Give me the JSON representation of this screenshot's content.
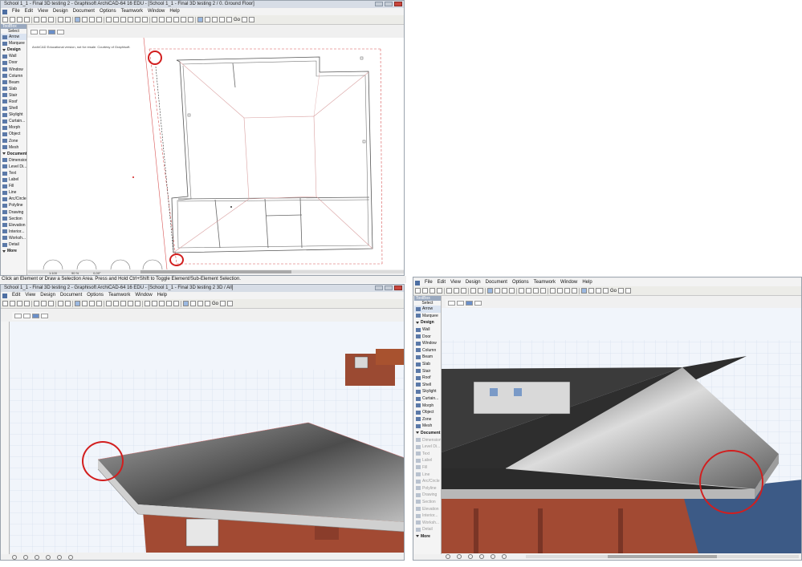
{
  "window_top": {
    "title": "School 1_1 - Final 3D testing 2 - Graphisoft ArchiCAD-64 16 EDU - [School 1_1 - Final 3D testing 2 / 0. Ground Floor]",
    "menu": [
      "File",
      "Edit",
      "View",
      "Design",
      "Document",
      "Options",
      "Teamwork",
      "Window",
      "Help"
    ],
    "zoom_label": "Go",
    "watermark": "ArchiCAD Educational version, not for resale. Courtesy of Graphisoft.",
    "scale_readout": "1:100",
    "zoom_readout": "90 %",
    "angle_readout": "0,00°"
  },
  "status_top": "Click an Element or Draw a Selection Area. Press and Hold Ctrl+Shift to Toggle Element/Sub-Element Selection.",
  "window_bottom_left": {
    "title": "School 1_1 - Final 3D testing 2 - Graphisoft ArchiCAD-64 16 EDU - [School 1_1 - Final 3D testing 2 3D / All]",
    "menu": [
      "Edit",
      "View",
      "Design",
      "Document",
      "Options",
      "Teamwork",
      "Window",
      "Help"
    ],
    "zoom_label": "Go"
  },
  "window_bottom_right": {
    "menu": [
      "File",
      "Edit",
      "View",
      "Design",
      "Document",
      "Options",
      "Teamwork",
      "Window",
      "Help"
    ],
    "zoom_label": "Go"
  },
  "toolbox": {
    "title": "ToolBox",
    "select_label": "Select",
    "items": [
      {
        "label": "Arrow",
        "kind": "tool",
        "icon": "arrow-icon"
      },
      {
        "label": "Marquee",
        "kind": "tool",
        "icon": "marquee-icon"
      },
      {
        "label": "Design",
        "kind": "group"
      },
      {
        "label": "Wall",
        "kind": "tool",
        "icon": "wall-icon"
      },
      {
        "label": "Door",
        "kind": "tool",
        "icon": "door-icon"
      },
      {
        "label": "Window",
        "kind": "tool",
        "icon": "window-icon"
      },
      {
        "label": "Column",
        "kind": "tool",
        "icon": "column-icon"
      },
      {
        "label": "Beam",
        "kind": "tool",
        "icon": "beam-icon"
      },
      {
        "label": "Slab",
        "kind": "tool",
        "icon": "slab-icon"
      },
      {
        "label": "Stair",
        "kind": "tool",
        "icon": "stair-icon"
      },
      {
        "label": "Roof",
        "kind": "tool",
        "icon": "roof-icon"
      },
      {
        "label": "Shell",
        "kind": "tool",
        "icon": "shell-icon"
      },
      {
        "label": "Skylight",
        "kind": "tool",
        "icon": "skylight-icon"
      },
      {
        "label": "Curtain...",
        "kind": "tool",
        "icon": "curtain-wall-icon"
      },
      {
        "label": "Morph",
        "kind": "tool",
        "icon": "morph-icon"
      },
      {
        "label": "Object",
        "kind": "tool",
        "icon": "object-icon"
      },
      {
        "label": "Zone",
        "kind": "tool",
        "icon": "zone-icon"
      },
      {
        "label": "Mesh",
        "kind": "tool",
        "icon": "mesh-icon"
      },
      {
        "label": "Document",
        "kind": "group"
      },
      {
        "label": "Dimension",
        "kind": "tool",
        "icon": "dimension-icon"
      },
      {
        "label": "Level Di...",
        "kind": "tool",
        "icon": "level-dimension-icon"
      },
      {
        "label": "Text",
        "kind": "tool",
        "icon": "text-icon"
      },
      {
        "label": "Label",
        "kind": "tool",
        "icon": "label-icon"
      },
      {
        "label": "Fill",
        "kind": "tool",
        "icon": "fill-icon"
      },
      {
        "label": "Line",
        "kind": "tool",
        "icon": "line-icon"
      },
      {
        "label": "Arc/Circle",
        "kind": "tool",
        "icon": "arc-icon"
      },
      {
        "label": "Polyline",
        "kind": "tool",
        "icon": "polyline-icon"
      },
      {
        "label": "Drawing",
        "kind": "tool",
        "icon": "drawing-icon"
      },
      {
        "label": "Section",
        "kind": "tool",
        "icon": "section-icon"
      },
      {
        "label": "Elevation",
        "kind": "tool",
        "icon": "elevation-icon"
      },
      {
        "label": "Interior...",
        "kind": "tool",
        "icon": "interior-elevation-icon"
      },
      {
        "label": "Worksh...",
        "kind": "tool",
        "icon": "worksheet-icon"
      },
      {
        "label": "Detail",
        "kind": "tool",
        "icon": "detail-icon"
      },
      {
        "label": "More",
        "kind": "group"
      }
    ]
  },
  "colors": {
    "annotation": "#d21e1e",
    "roof_dark": "#3b3b3b",
    "roof_light": "#b5b5b5",
    "brick": "#a24a33",
    "grid_bg": "#e8eef7"
  }
}
